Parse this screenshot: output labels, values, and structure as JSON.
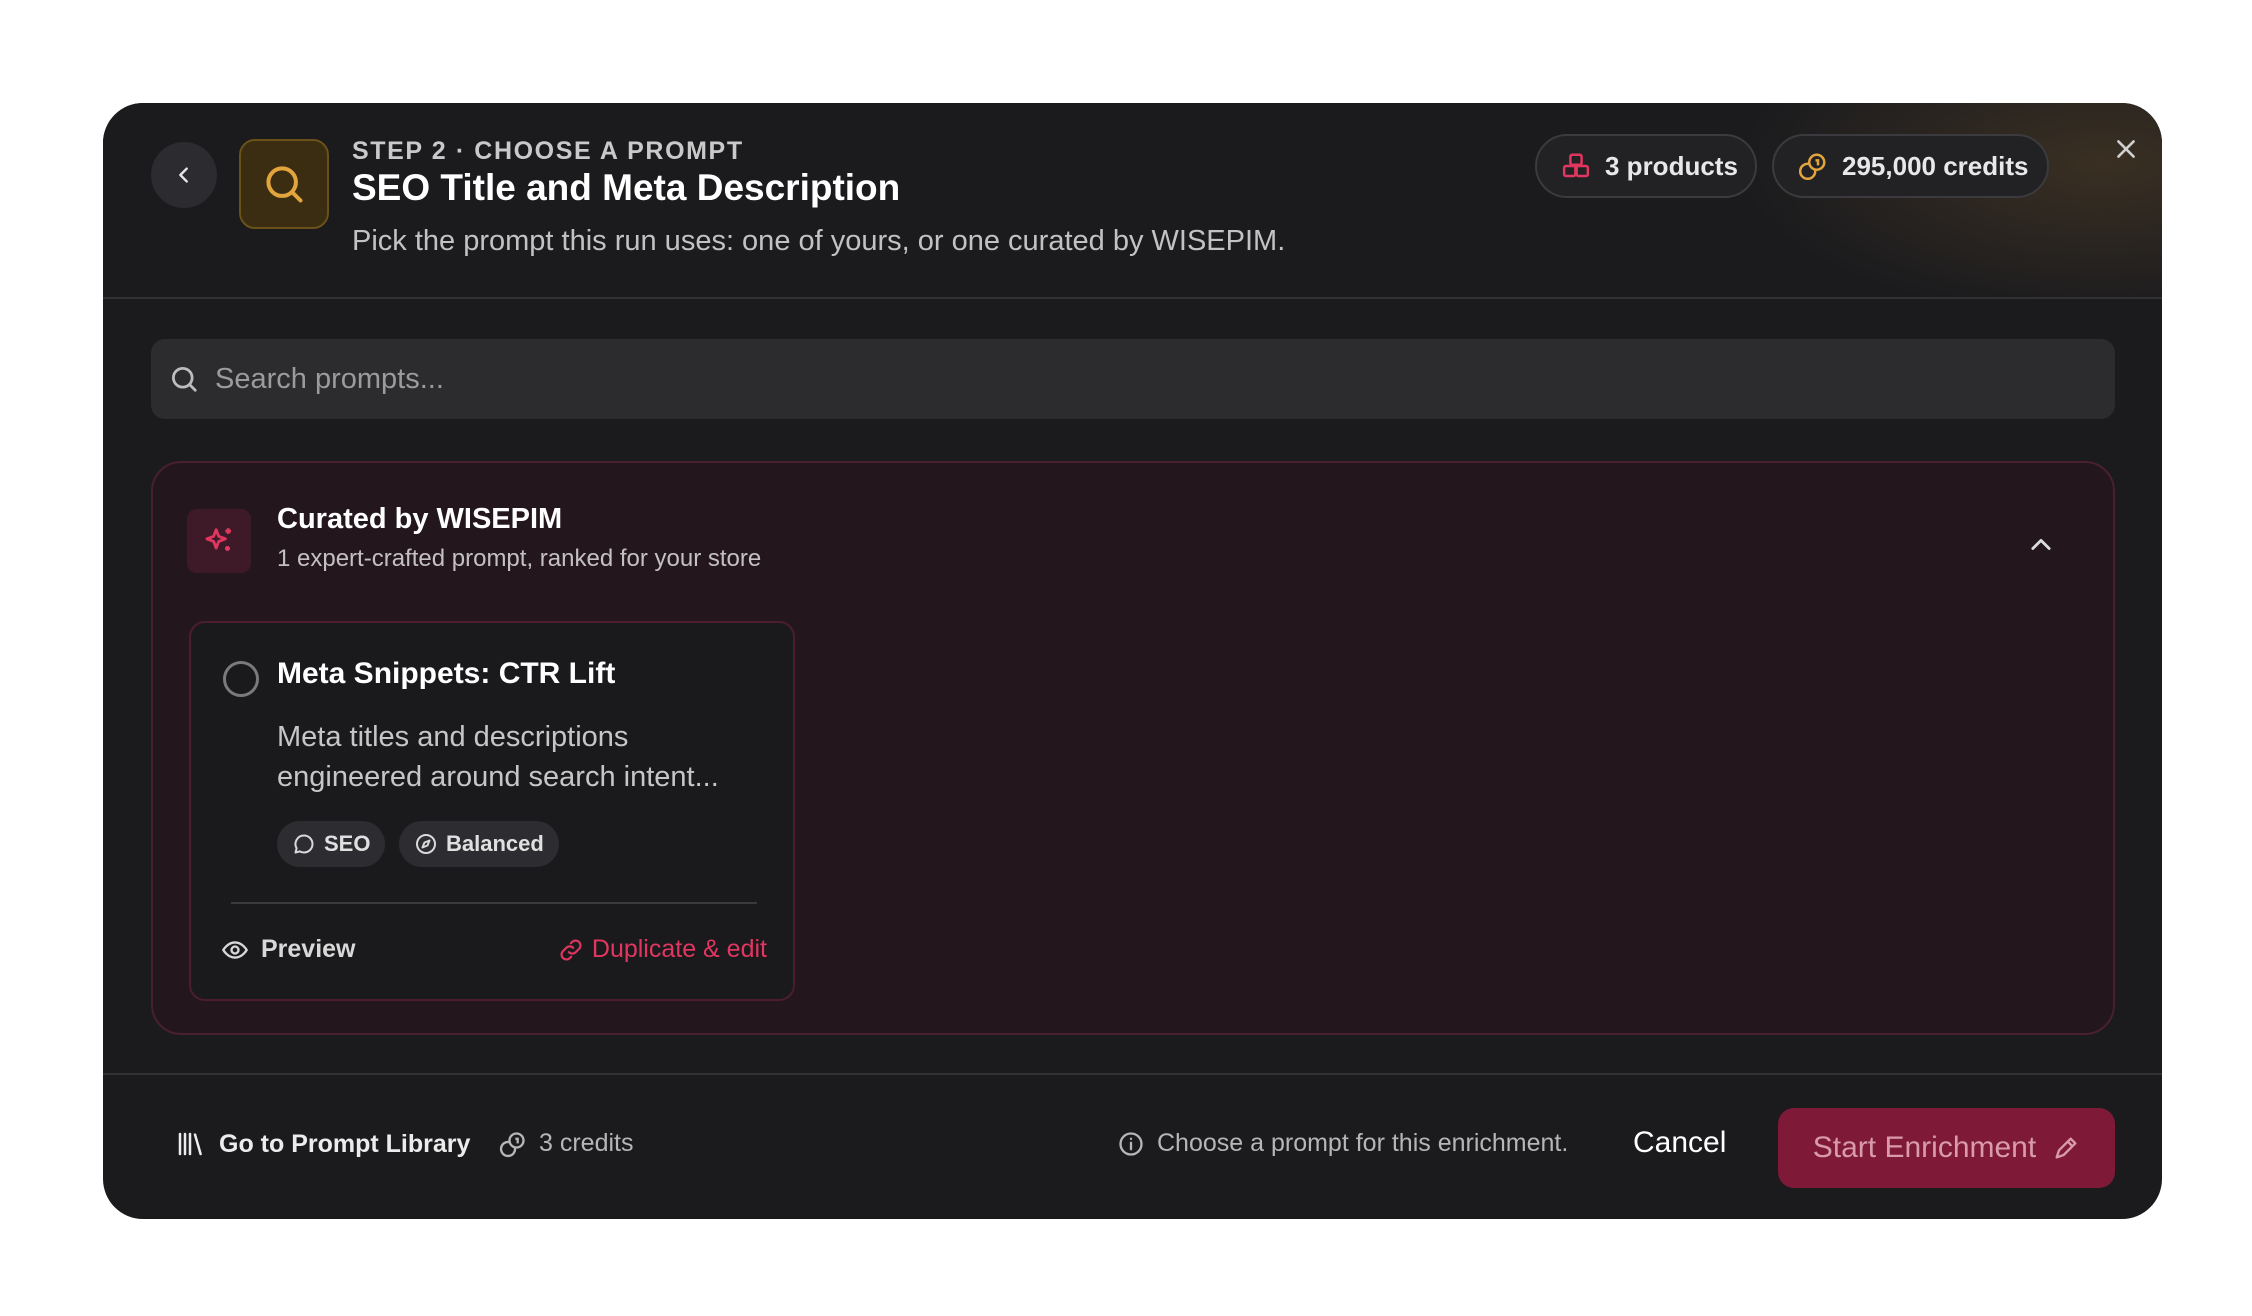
{
  "header": {
    "step_label": "STEP 2 · CHOOSE A PROMPT",
    "title": "SEO Title and Meta Description",
    "subtitle": "Pick the prompt this run uses: one of yours, or one curated by WISEPIM.",
    "products_pill": "3 products",
    "credits_pill": "295,000 credits"
  },
  "search": {
    "placeholder": "Search prompts..."
  },
  "curated": {
    "title": "Curated by WISEPIM",
    "subtitle": "1 expert-crafted prompt, ranked for your store",
    "expanded": true,
    "prompts": [
      {
        "title": "Meta Snippets: CTR Lift",
        "description": "Meta titles and descriptions engineered around search intent...",
        "tags": [
          "SEO",
          "Balanced"
        ],
        "preview_label": "Preview",
        "duplicate_label": "Duplicate & edit",
        "selected": false
      }
    ]
  },
  "footer": {
    "library_label": "Go to Prompt Library",
    "credits_cost": "3 credits",
    "hint": "Choose a prompt for this enrichment.",
    "cancel_label": "Cancel",
    "start_label": "Start Enrichment"
  },
  "colors": {
    "accent": "#e0365f",
    "start_button_bg": "#7e1937",
    "credits_icon": "#e2a43c",
    "step_icon": "#e2a43c"
  },
  "icons": {
    "back": "chevron-left-icon",
    "step": "search-icon",
    "products": "boxes-icon",
    "credits": "coins-icon",
    "close": "close-icon",
    "curated": "sparkles-icon",
    "collapse": "chevron-up-icon",
    "seo_tag": "message-circle-icon",
    "balanced_tag": "compass-icon",
    "preview": "eye-icon",
    "duplicate": "link-icon",
    "library": "library-icon",
    "credits_cost": "coins-icon",
    "hint": "info-icon",
    "start": "wand-icon"
  }
}
